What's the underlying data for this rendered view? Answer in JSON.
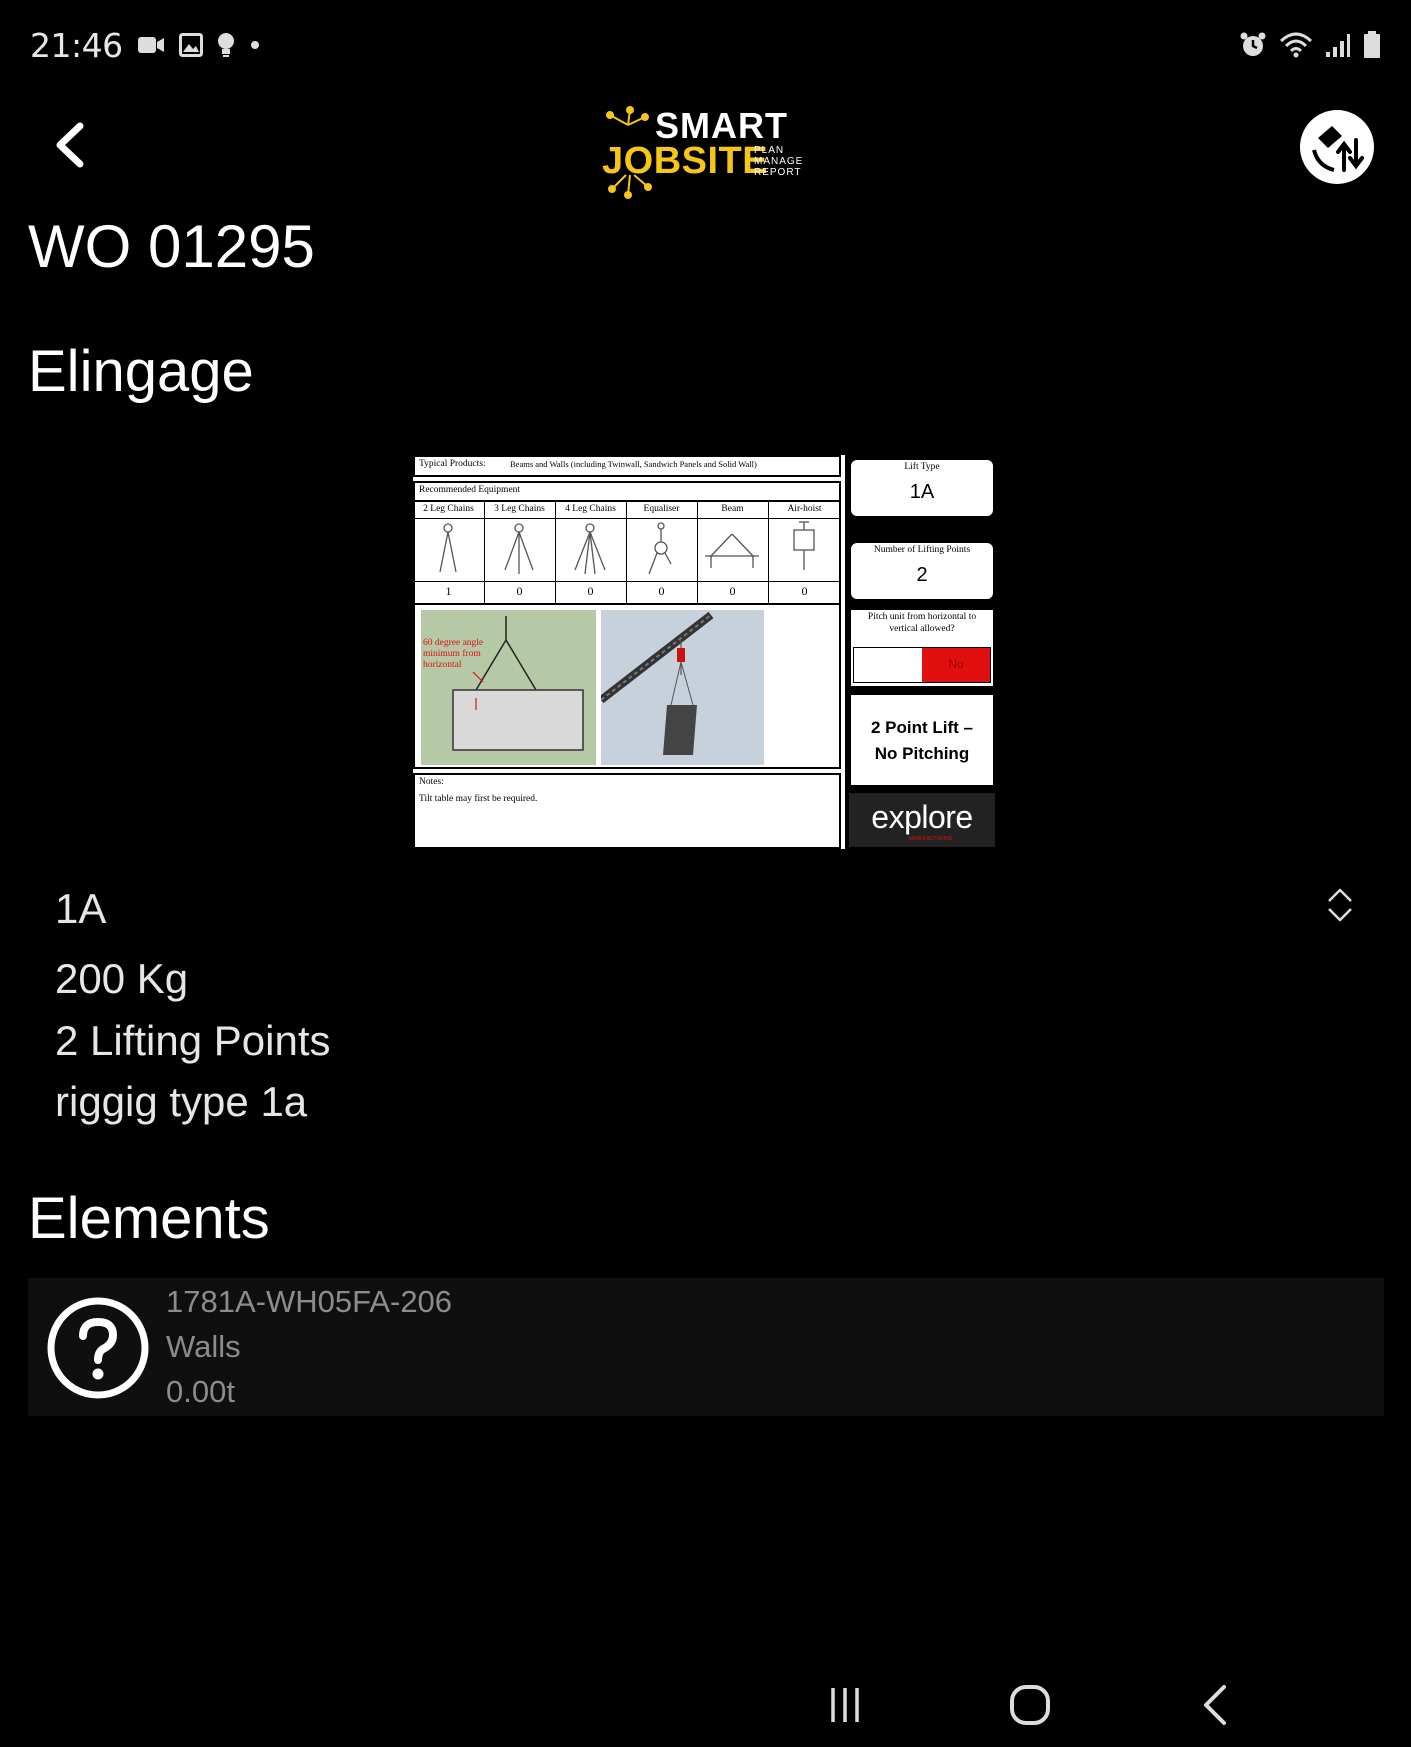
{
  "status_bar": {
    "time": "21:46",
    "left_icons": [
      "video-icon",
      "image-icon",
      "bulb-icon",
      "dot-icon"
    ],
    "right_icons": [
      "alarm-icon",
      "wifi-icon",
      "signal-icon",
      "battery-icon"
    ]
  },
  "header": {
    "back_icon": "chevron-left-icon",
    "logo": {
      "line1": "SMART",
      "line2": "JOBSITE",
      "tag1": "PLAN",
      "tag2": "MANAGE",
      "tag3": "REPORT"
    },
    "sync_icon": "sync-icon",
    "colors": {
      "logo_yellow": "#f5c518"
    }
  },
  "work_order": {
    "title": "WO 01295"
  },
  "elingage": {
    "heading": "Elingage",
    "sheet": {
      "typical_products_label": "Typical Products:",
      "typical_products_value": "Beams and Walls (including Twinwall, Sandwich Panels and Solid Wall)",
      "recommended_equipment": "Recommended Equipment",
      "equipment": [
        {
          "name": "2 Leg Chains",
          "count": "1"
        },
        {
          "name": "3 Leg Chains",
          "count": "0"
        },
        {
          "name": "4 Leg Chains",
          "count": "0"
        },
        {
          "name": "Equaliser",
          "count": "0"
        },
        {
          "name": "Beam",
          "count": "0"
        },
        {
          "name": "Air-hoist",
          "count": "0"
        }
      ],
      "diagram_note": "60 degree angle minimum from horizontal",
      "notes_label": "Notes:",
      "notes_text": "Tilt table may first be required.",
      "lift_type_label": "Lift Type",
      "lift_type_value": "1A",
      "lifting_points_label": "Number of Lifting Points",
      "lifting_points_value": "2",
      "pitch_question": "Pitch unit from horizontal to vertical allowed?",
      "pitch_answer": "No",
      "summary_line1": "2 Point Lift –",
      "summary_line2": "No Pitching",
      "brand": "explore",
      "brand_sub": "MANUFACTURING",
      "colors": {
        "no_red": "#e01010",
        "diagram_green": "#b6c9a6",
        "sky": "#c7d1dc"
      }
    },
    "details": {
      "type": "1A",
      "weight": "200 Kg",
      "lifting_points": "2 Lifting Points",
      "rigging": "riggig type 1a"
    },
    "expand_icon": "chevron-up-down-icon"
  },
  "elements": {
    "heading": "Elements",
    "items": [
      {
        "icon": "question-circle-icon",
        "code": "1781A-WH05FA-206",
        "category": "Walls",
        "weight": "0.00t"
      }
    ]
  },
  "nav_bar": {
    "recents_icon": "recents-icon",
    "home_icon": "home-icon",
    "back_icon": "back-icon"
  }
}
